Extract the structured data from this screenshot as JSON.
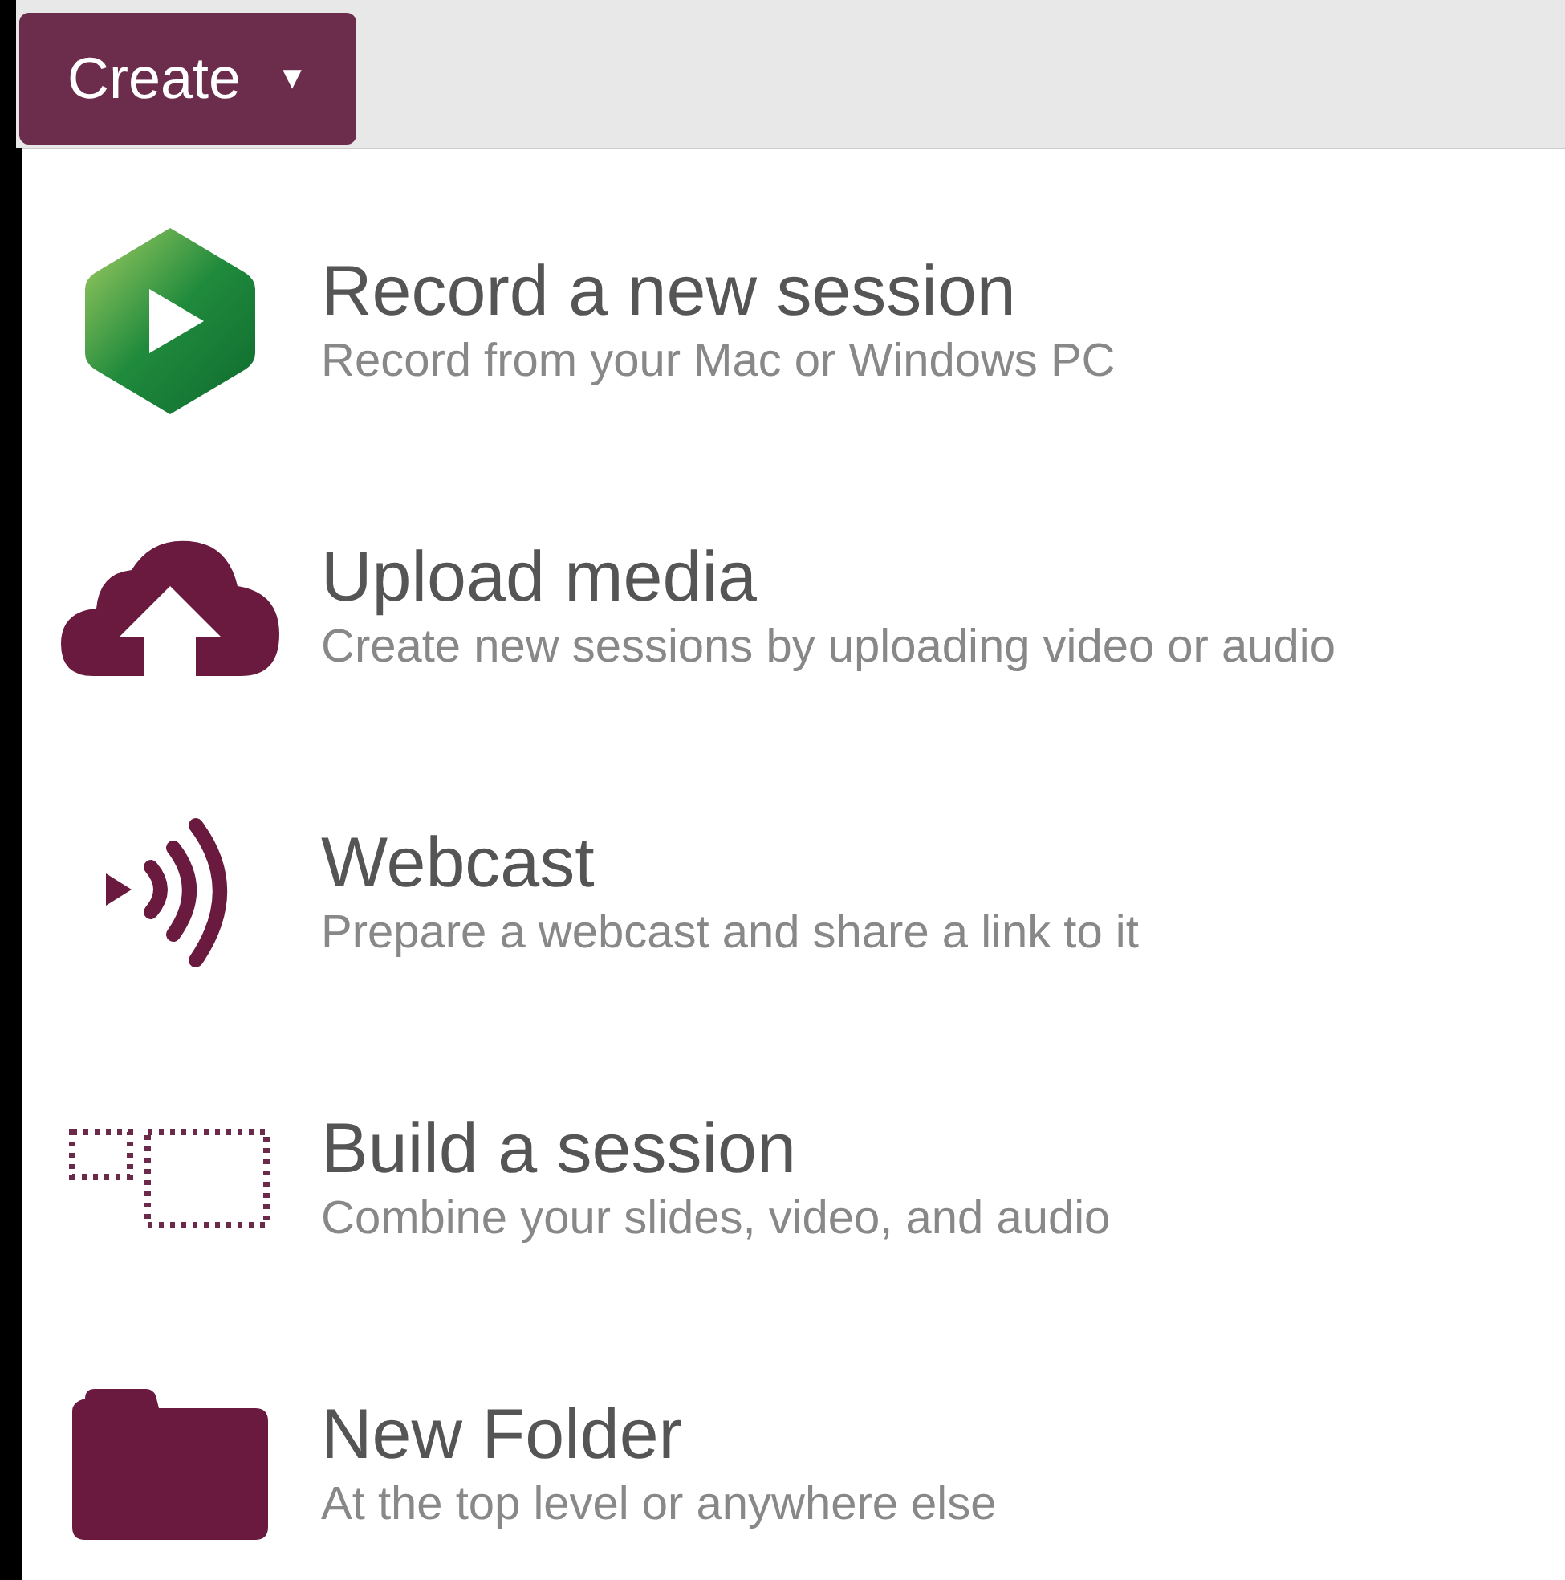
{
  "create_button": {
    "label": "Create",
    "caret": "▼"
  },
  "menu_items": [
    {
      "kind": "logo",
      "title": "Record a new session",
      "subtitle": "Record from your Mac or Windows PC"
    },
    {
      "kind": "upload",
      "title": "Upload media",
      "subtitle": "Create new sessions by uploading video or audio"
    },
    {
      "kind": "webcast",
      "title": "Webcast",
      "subtitle": "Prepare a webcast and share a link to it"
    },
    {
      "kind": "build",
      "title": "Build a session",
      "subtitle": "Combine your slides, video, and audio"
    },
    {
      "kind": "folder",
      "title": "New Folder",
      "subtitle": "At the top level or anywhere else"
    }
  ]
}
